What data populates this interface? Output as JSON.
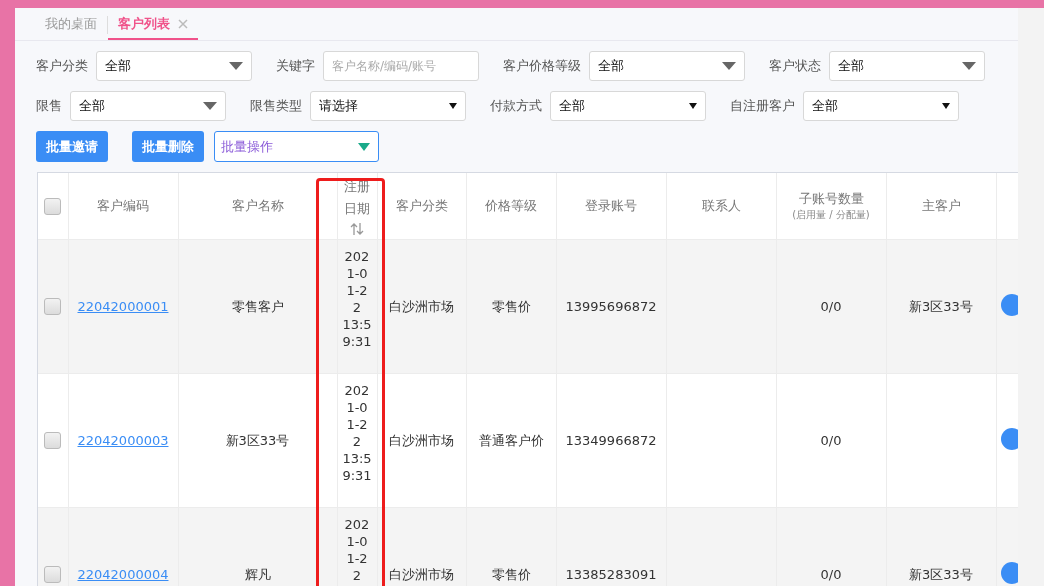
{
  "tabs": [
    {
      "label": "我的桌面",
      "selected": false,
      "closable": false
    },
    {
      "label": "客户列表",
      "selected": true,
      "closable": true
    }
  ],
  "filter_rows": [
    [
      {
        "label": "客户分类",
        "kind": "select",
        "value": "全部"
      },
      {
        "label": "关键字",
        "kind": "input",
        "placeholder": "客户名称/编码/账号"
      },
      {
        "label": "客户价格等级",
        "kind": "select",
        "value": "全部"
      },
      {
        "label": "客户状态",
        "kind": "select",
        "value": "全部"
      }
    ],
    [
      {
        "label": "限售",
        "kind": "select",
        "value": "全部"
      },
      {
        "label": "限售类型",
        "kind": "native",
        "value": "请选择"
      },
      {
        "label": "付款方式",
        "kind": "native",
        "value": "全部"
      },
      {
        "label": "自注册客户",
        "kind": "native",
        "value": "全部"
      }
    ]
  ],
  "actions": [
    {
      "label": "批量邀请",
      "kind": "button"
    },
    {
      "label": "批量删除",
      "kind": "button"
    },
    {
      "label": "批量操作",
      "kind": "dropdown"
    }
  ],
  "table": {
    "all_checked": false,
    "columns": [
      {
        "label": "客户编码",
        "sortable": false
      },
      {
        "label": "客户名称",
        "sortable": false
      },
      {
        "label": "注册日期",
        "sortable": true
      },
      {
        "label": "客户分类",
        "sortable": false
      },
      {
        "label": "价格等级",
        "sortable": false
      },
      {
        "label": "登录账号",
        "sortable": false
      },
      {
        "label": "联系人",
        "sortable": false
      },
      {
        "label": "子账号数量",
        "sublabel": "(启用量 / 分配量)",
        "sortable": false
      },
      {
        "label": "主客户",
        "sortable": false
      }
    ],
    "rows": [
      {
        "checked": false,
        "code": "22042000001",
        "name": "零售客户",
        "date": "2021-01-22 13:59:31",
        "category": "白沙洲市场",
        "price_level": "零售价",
        "account": "13995696872",
        "sub_accounts": "0/0",
        "main_customer": "新3区33号"
      },
      {
        "checked": false,
        "code": "22042000003",
        "name": "新3区33号",
        "date": "2021-01-22 13:59:31",
        "category": "白沙洲市场",
        "price_level": "普通客户价",
        "account": "13349966872",
        "sub_accounts": "0/0"
      },
      {
        "checked": false,
        "code": "22042000004",
        "name": "辉凡",
        "date": "2021-01-22",
        "category": "白沙洲市场",
        "price_level": "零售价",
        "account": "13385283091",
        "sub_accounts": "0/0",
        "main_customer": "新3区33号"
      }
    ]
  }
}
